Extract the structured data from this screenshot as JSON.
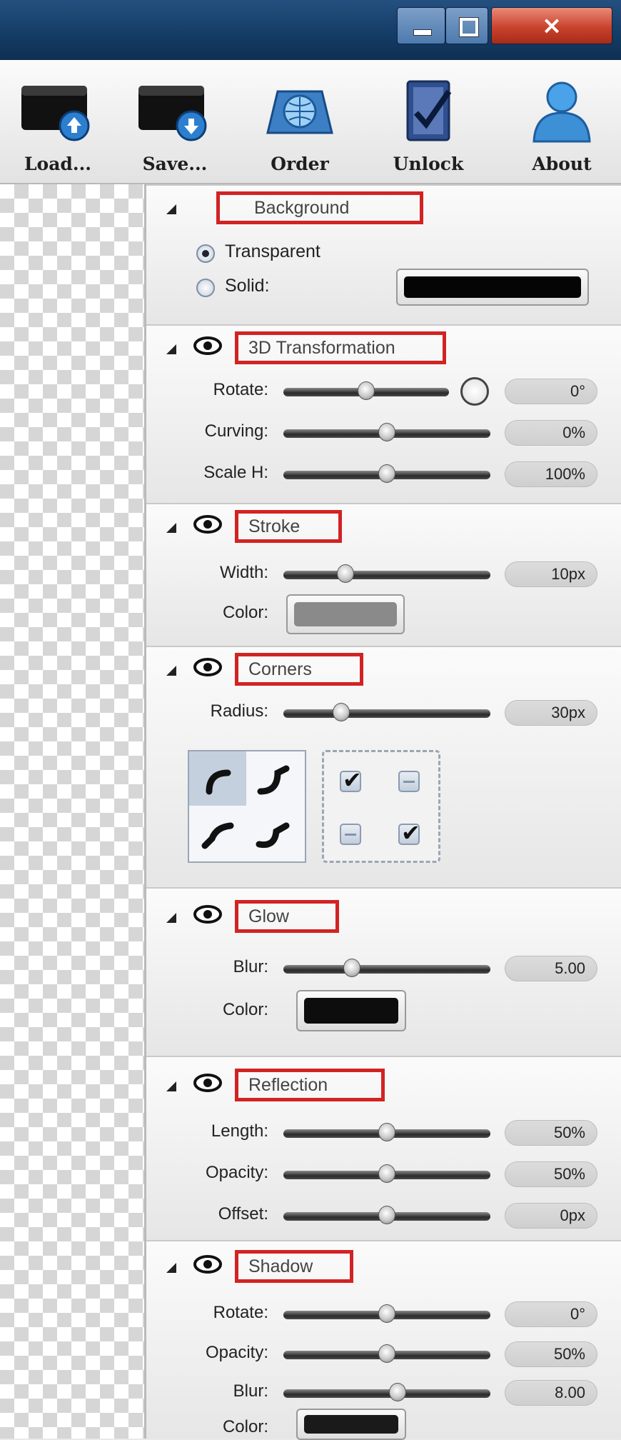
{
  "window": {
    "close_glyph": "×"
  },
  "toolbar": [
    {
      "id": "load",
      "label": "Load...",
      "icon": "folder-upload-icon"
    },
    {
      "id": "save",
      "label": "Save...",
      "icon": "folder-download-icon"
    },
    {
      "id": "order",
      "label": "Order",
      "icon": "globe-cart-icon"
    },
    {
      "id": "unlock",
      "label": "Unlock",
      "icon": "key-check-icon"
    },
    {
      "id": "about",
      "label": "About",
      "icon": "user-icon"
    }
  ],
  "background": {
    "title": "Background",
    "options": [
      {
        "label": "Transparent",
        "selected": true
      },
      {
        "label": "Solid:",
        "selected": false
      }
    ],
    "solid_color": "#050505"
  },
  "transform": {
    "title": "3D Transformation",
    "rows": [
      {
        "label": "Rotate:",
        "value": "0°",
        "position": 0.5
      },
      {
        "label": "Curving:",
        "value": "0%",
        "position": 0.5
      },
      {
        "label": "Scale H:",
        "value": "100%",
        "position": 0.5
      }
    ]
  },
  "stroke": {
    "title": "Stroke",
    "width_label": "Width:",
    "width_value": "10px",
    "width_position": 0.3,
    "color_label": "Color:",
    "color": "#8a8a8a"
  },
  "corners": {
    "title": "Corners",
    "radius_label": "Radius:",
    "radius_value": "30px",
    "radius_position": 0.28,
    "checks": [
      true,
      false,
      false,
      true
    ]
  },
  "glow": {
    "title": "Glow",
    "blur_label": "Blur:",
    "blur_value": "5.00",
    "blur_position": 0.33,
    "color_label": "Color:",
    "color": "#0d0d0d"
  },
  "reflection": {
    "title": "Reflection",
    "rows": [
      {
        "label": "Length:",
        "value": "50%",
        "position": 0.5
      },
      {
        "label": "Opacity:",
        "value": "50%",
        "position": 0.5
      },
      {
        "label": "Offset:",
        "value": "0px",
        "position": 0.5
      }
    ]
  },
  "shadow": {
    "title": "Shadow",
    "rows": [
      {
        "label": "Rotate:",
        "value": "0°",
        "position": 0.5
      },
      {
        "label": "Opacity:",
        "value": "50%",
        "position": 0.5
      },
      {
        "label": "Blur:",
        "value": "8.00",
        "position": 0.55
      }
    ],
    "color_label": "Color:",
    "color": "#1a1a1a"
  }
}
